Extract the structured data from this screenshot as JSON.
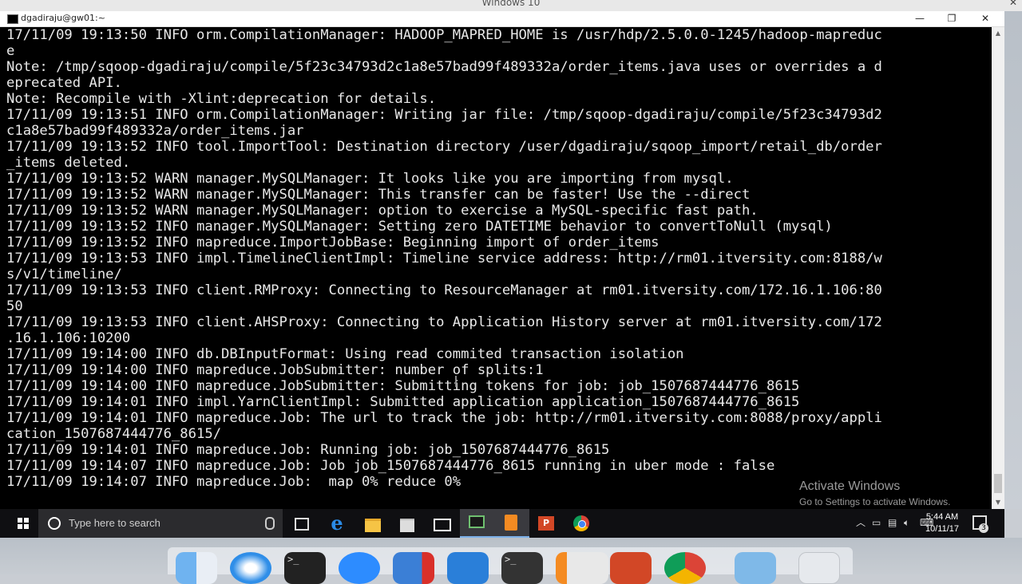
{
  "host": {
    "title": "Windows 10"
  },
  "terminal": {
    "title": "dgadiraju@gw01:~",
    "window_controls": {
      "minimize": "—",
      "maximize": "❐",
      "close": "✕"
    },
    "lines": [
      "17/11/09 19:13:50 INFO orm.CompilationManager: HADOOP_MAPRED_HOME is /usr/hdp/2.5.0.0-1245/hadoop-mapreduc",
      "e",
      "Note: /tmp/sqoop-dgadiraju/compile/5f23c34793d2c1a8e57bad99f489332a/order_items.java uses or overrides a d",
      "eprecated API.",
      "Note: Recompile with -Xlint:deprecation for details.",
      "17/11/09 19:13:51 INFO orm.CompilationManager: Writing jar file: /tmp/sqoop-dgadiraju/compile/5f23c34793d2",
      "c1a8e57bad99f489332a/order_items.jar",
      "17/11/09 19:13:52 INFO tool.ImportTool: Destination directory /user/dgadiraju/sqoop_import/retail_db/order",
      "_items deleted.",
      "17/11/09 19:13:52 WARN manager.MySQLManager: It looks like you are importing from mysql.",
      "17/11/09 19:13:52 WARN manager.MySQLManager: This transfer can be faster! Use the --direct",
      "17/11/09 19:13:52 WARN manager.MySQLManager: option to exercise a MySQL-specific fast path.",
      "17/11/09 19:13:52 INFO manager.MySQLManager: Setting zero DATETIME behavior to convertToNull (mysql)",
      "17/11/09 19:13:52 INFO mapreduce.ImportJobBase: Beginning import of order_items",
      "17/11/09 19:13:53 INFO impl.TimelineClientImpl: Timeline service address: http://rm01.itversity.com:8188/w",
      "s/v1/timeline/",
      "17/11/09 19:13:53 INFO client.RMProxy: Connecting to ResourceManager at rm01.itversity.com/172.16.1.106:80",
      "50",
      "17/11/09 19:13:53 INFO client.AHSProxy: Connecting to Application History server at rm01.itversity.com/172",
      ".16.1.106:10200",
      "17/11/09 19:14:00 INFO db.DBInputFormat: Using read commited transaction isolation",
      "17/11/09 19:14:00 INFO mapreduce.JobSubmitter: number of splits:1",
      "17/11/09 19:14:00 INFO mapreduce.JobSubmitter: Submitting tokens for job: job_1507687444776_8615",
      "17/11/09 19:14:01 INFO impl.YarnClientImpl: Submitted application application_1507687444776_8615",
      "17/11/09 19:14:01 INFO mapreduce.Job: The url to track the job: http://rm01.itversity.com:8088/proxy/appli",
      "cation_1507687444776_8615/",
      "17/11/09 19:14:01 INFO mapreduce.Job: Running job: job_1507687444776_8615",
      "17/11/09 19:14:07 INFO mapreduce.Job: Job job_1507687444776_8615 running in uber mode : false",
      "17/11/09 19:14:07 INFO mapreduce.Job:  map 0% reduce 0%"
    ]
  },
  "watermark": {
    "title": "Activate Windows",
    "subtitle": "Go to Settings to activate Windows."
  },
  "taskbar": {
    "search_placeholder": "Type here to search",
    "clock_time": "5:44 AM",
    "clock_date": "10/11/17",
    "notification_count": "3",
    "accent_color": "#7cb0e8",
    "apps": [
      "task-view-icon",
      "edge-icon",
      "file-explorer-icon",
      "store-icon",
      "mail-icon",
      "terminal-icon",
      "sublime-text-icon",
      "powerpoint-icon",
      "chrome-icon"
    ]
  },
  "dock": {
    "apps": [
      "finder-icon",
      "safari-icon",
      "terminal-icon",
      "zoom-icon",
      "windows-vm-icon",
      "remote-desktop-icon",
      "terminal-icon",
      "sublime-text-icon",
      "powerpoint-icon",
      "chrome-icon",
      "folder-icon",
      "trash-icon"
    ]
  }
}
